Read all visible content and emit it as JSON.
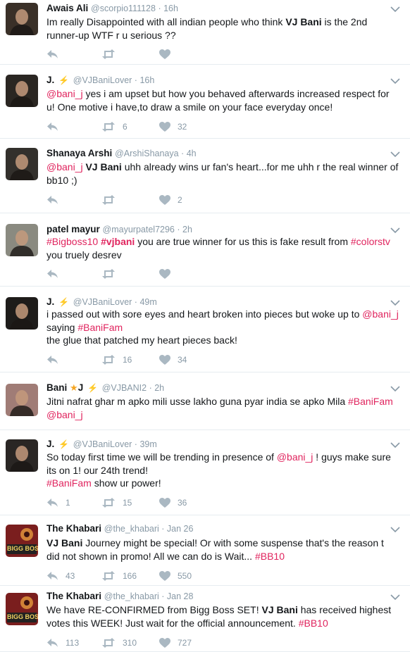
{
  "tweets": [
    {
      "name": "Awais Ali",
      "handle": "@scorpio111128",
      "time": "16h",
      "segments": [
        {
          "t": "Im really Disappointed with all indian people who think "
        },
        {
          "t": "VJ Bani",
          "c": "strong"
        },
        {
          "t": " is the 2nd runner-up WTF r u serious ??"
        }
      ],
      "replies": "",
      "retweets": "",
      "likes": ""
    },
    {
      "name": "J.",
      "badge": "⚡",
      "handle": "@VJBaniLover",
      "time": "16h",
      "segments": [
        {
          "t": "@bani_j",
          "c": "mention"
        },
        {
          "t": " yes i am upset but how you behaved afterwards increased respect for u! One motive i have,to draw a smile on your face everyday once!"
        }
      ],
      "replies": "",
      "retweets": "6",
      "likes": "32"
    },
    {
      "name": "Shanaya Arshi",
      "handle": "@ArshiShanaya",
      "time": "4h",
      "segments": [
        {
          "t": "@bani_j",
          "c": "mention"
        },
        {
          "t": " "
        },
        {
          "t": "VJ Bani",
          "c": "strong"
        },
        {
          "t": " uhh already wins ur fan's heart...for me uhh r the real winner of bb10 ;)"
        }
      ],
      "replies": "",
      "retweets": "",
      "likes": "2"
    },
    {
      "name": "patel mayur",
      "handle": "@mayurpatel7296",
      "time": "2h",
      "segments": [
        {
          "t": "#Bigboss10",
          "c": "hashtag"
        },
        {
          "t": " "
        },
        {
          "t": "#vjbani",
          "c": "hashtag strong"
        },
        {
          "t": " you are true winner for us this is fake result from "
        },
        {
          "t": "#colorstv",
          "c": "hashtag"
        },
        {
          "t": " you truely desrev"
        }
      ],
      "replies": "",
      "retweets": "",
      "likes": ""
    },
    {
      "name": "J.",
      "badge": "⚡",
      "handle": "@VJBaniLover",
      "time": "49m",
      "segments": [
        {
          "t": "i passed out with sore eyes and heart broken into pieces but woke up to "
        },
        {
          "t": "@bani_j",
          "c": "mention"
        },
        {
          "t": " saying "
        },
        {
          "t": "#BaniFam",
          "c": "hashtag"
        },
        {
          "t": "\nthe glue that patched my heart pieces back!"
        }
      ],
      "replies": "",
      "retweets": "16",
      "likes": "34"
    },
    {
      "name": "Bani",
      "star": "★",
      "name_suffix": "J",
      "badge": "⚡",
      "handle": "@VJBANI2",
      "time": "2h",
      "segments": [
        {
          "t": "Jitni nafrat ghar m apko mili usse lakho guna pyar india se apko Mila "
        },
        {
          "t": "#BaniFam",
          "c": "hashtag"
        },
        {
          "t": " "
        },
        {
          "t": "@bani_j",
          "c": "mention"
        }
      ],
      "replies": "",
      "retweets": "",
      "likes": "",
      "no_actions": true
    },
    {
      "name": "J.",
      "badge": "⚡",
      "handle": "@VJBaniLover",
      "time": "39m",
      "segments": [
        {
          "t": "So today first time we will be trending in presence of "
        },
        {
          "t": "@bani_j",
          "c": "mention"
        },
        {
          "t": " ! guys make sure its on 1! our 24th trend!\n"
        },
        {
          "t": "#BaniFam",
          "c": "hashtag"
        },
        {
          "t": " show ur power!"
        }
      ],
      "replies": "1",
      "retweets": "15",
      "likes": "36"
    },
    {
      "name": "The Khabari",
      "handle": "@the_khabari",
      "time": "Jan 26",
      "segments": [
        {
          "t": "VJ Bani",
          "c": "strong"
        },
        {
          "t": " Journey might be special! Or with some suspense that's the reason t did not shown in promo! All we can do is Wait... "
        },
        {
          "t": "#BB10",
          "c": "hashtag"
        }
      ],
      "replies": "43",
      "retweets": "166",
      "likes": "550",
      "avatar_text": "BIGG BOSS"
    },
    {
      "name": "The Khabari",
      "handle": "@the_khabari",
      "time": "Jan 28",
      "segments": [
        {
          "t": "We have RE-CONFIRMED from Bigg Boss SET! "
        },
        {
          "t": "VJ Bani",
          "c": "strong"
        },
        {
          "t": " has received highest votes this WEEK! Just wait for the official announcement. "
        },
        {
          "t": "#BB10",
          "c": "hashtag"
        }
      ],
      "replies": "113",
      "retweets": "310",
      "likes": "727",
      "avatar_text": "BIGG BOSS"
    }
  ],
  "icons": {
    "reply": "reply-icon",
    "retweet": "retweet-icon",
    "like": "heart-icon",
    "more": "chevron-down-icon"
  },
  "colors": {
    "link": "#e0245e",
    "muted": "#8899a6",
    "verified": "#f5a623"
  }
}
